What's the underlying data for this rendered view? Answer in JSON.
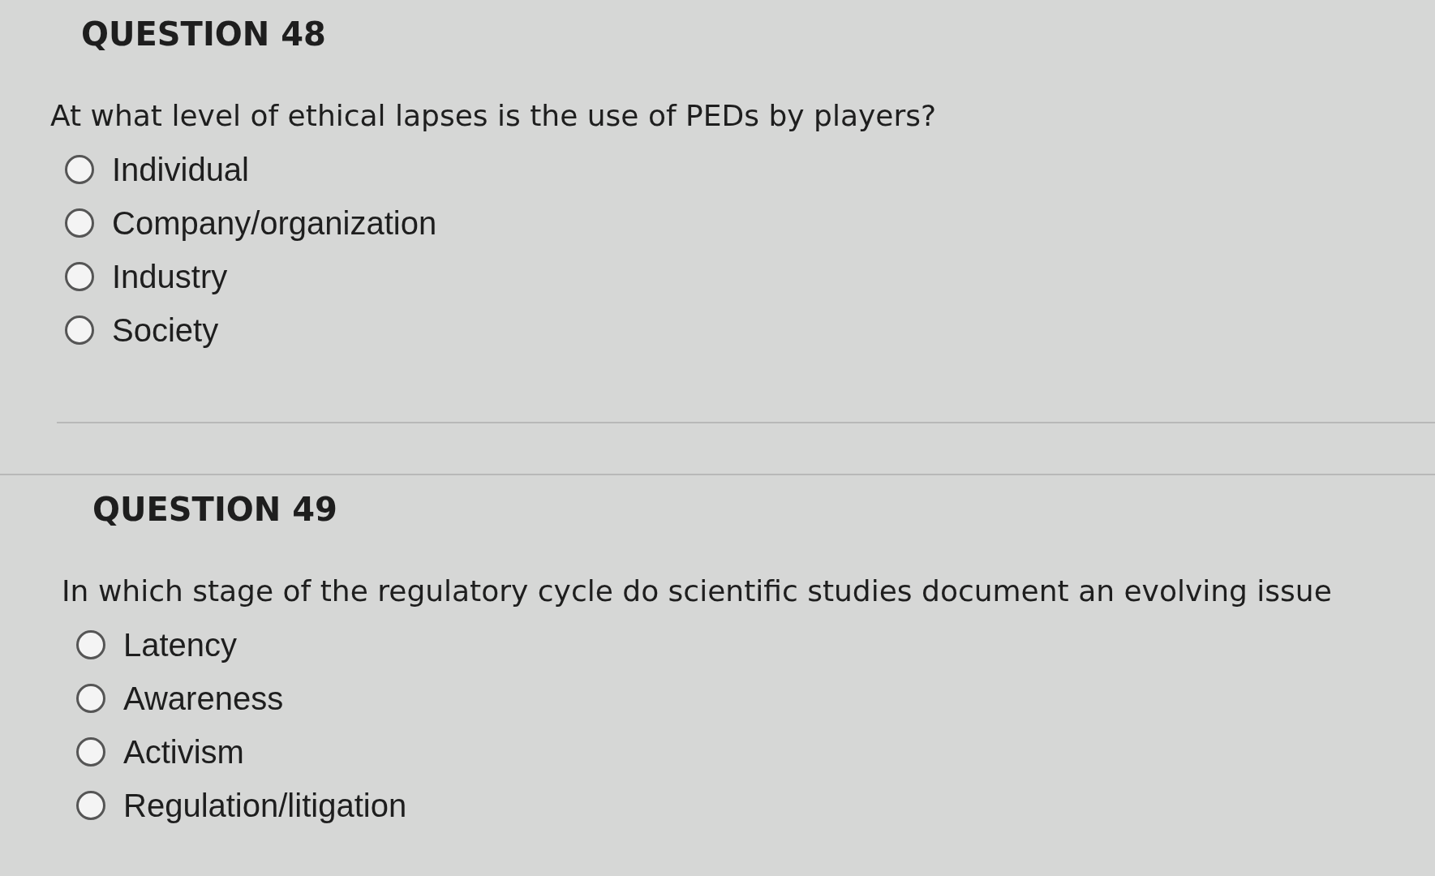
{
  "questions": [
    {
      "heading": "QUESTION 48",
      "text": "At what level of ethical lapses is the use of PEDs by players?",
      "options": [
        {
          "label": "Individual",
          "selected": false
        },
        {
          "label": "Company/organization",
          "selected": false
        },
        {
          "label": "Industry",
          "selected": false
        },
        {
          "label": "Society",
          "selected": false
        }
      ]
    },
    {
      "heading": "QUESTION 49",
      "text": "In which stage of the regulatory cycle do scientific studies document an evolving issue",
      "options": [
        {
          "label": "Latency",
          "selected": false
        },
        {
          "label": "Awareness",
          "selected": false
        },
        {
          "label": "Activism",
          "selected": false
        },
        {
          "label": "Regulation/litigation",
          "selected": false
        }
      ]
    }
  ]
}
